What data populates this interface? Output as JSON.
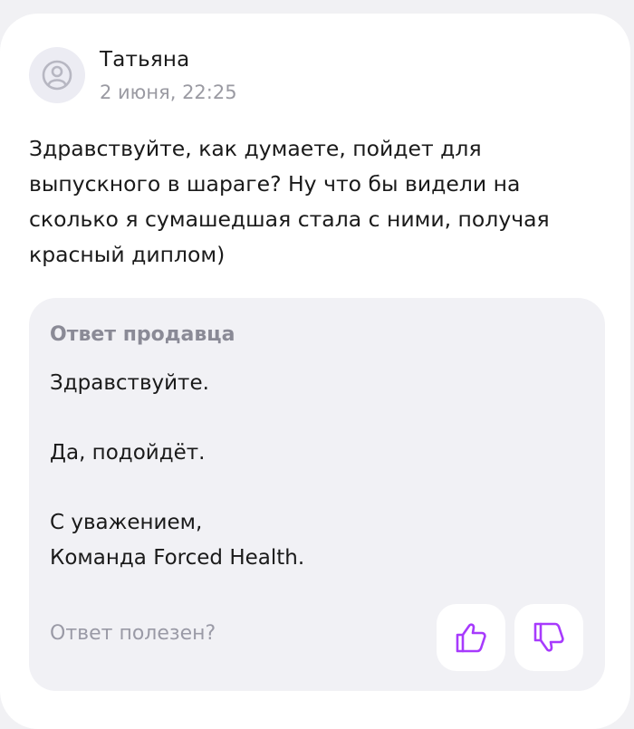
{
  "review": {
    "author_name": "Татьяна",
    "date": "2 июня, 22:25",
    "avatar_icon": "user-icon",
    "text": "Здравствуйте, как думаете, пойдет для\nвыпускного в шараге? Ну что бы видели на\nсколько я сумашедшая стала с ними, получая\nкрасный диплом)"
  },
  "seller_reply": {
    "title": "Ответ продавца",
    "text": "Здравствуйте.\n\nДа, подойдёт.\n\nС уважением,\nКоманда Forced Health."
  },
  "feedback": {
    "question": "Ответ полезен?",
    "like_icon": "thumbs-up-icon",
    "dislike_icon": "thumbs-down-icon",
    "accent_color": "#a73afd"
  }
}
